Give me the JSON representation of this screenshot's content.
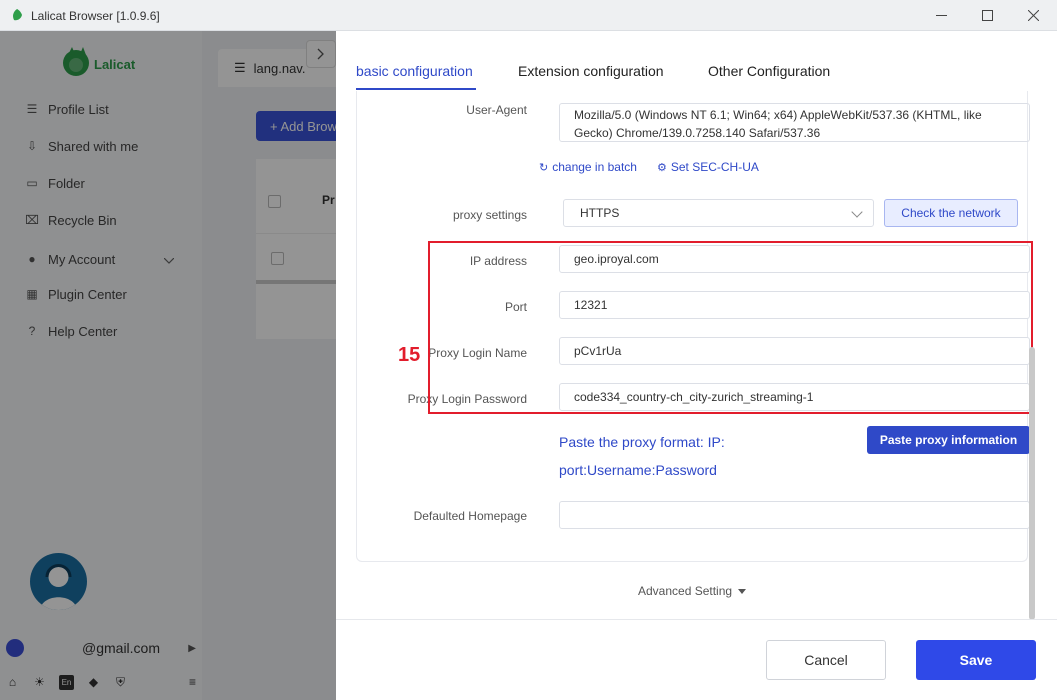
{
  "window": {
    "title": "Lalicat Browser  [1.0.9.6]",
    "minimize_icon": "minimize-icon",
    "maximize_icon": "maximize-icon",
    "close_icon": "close-icon"
  },
  "sidebar": {
    "logo_text": "Lalicat",
    "items": [
      {
        "label": "Profile List",
        "icon": "list-icon"
      },
      {
        "label": "Shared with me",
        "icon": "share-icon"
      },
      {
        "label": "Folder",
        "icon": "folder-icon"
      },
      {
        "label": "Recycle Bin",
        "icon": "trash-icon"
      },
      {
        "label": "My Account",
        "icon": "account-icon"
      },
      {
        "label": "Plugin Center",
        "icon": "plugin-icon"
      },
      {
        "label": "Help Center",
        "icon": "help-icon"
      }
    ],
    "account_email": "@gmail.com"
  },
  "background": {
    "tab_label": "lang.nav.",
    "add_button_label": "+ Add Brow",
    "column_header": "Pr"
  },
  "drawer": {
    "tabs": [
      {
        "label": "basic configuration",
        "active": true
      },
      {
        "label": "Extension configuration",
        "active": false
      },
      {
        "label": "Other Configuration",
        "active": false
      }
    ],
    "user_agent": {
      "label": "User-Agent",
      "value": "Mozilla/5.0 (Windows NT 6.1; Win64; x64) AppleWebKit/537.36 (KHTML, like Gecko) Chrome/139.0.7258.140 Safari/537.36"
    },
    "links": {
      "change_batch": "change in batch",
      "set_sec_ch_ua": "Set SEC-CH-UA"
    },
    "proxy": {
      "label": "proxy settings",
      "selected": "HTTPS",
      "check_button": "Check the network"
    },
    "annotation": "15",
    "fields": [
      {
        "label": "IP address",
        "value": "geo.iproyal.com"
      },
      {
        "label": "Port",
        "value": "12321"
      },
      {
        "label": "Proxy Login Name",
        "value": "pCv1rUa"
      },
      {
        "label": "Proxy Login Password",
        "value": "code334_country-ch_city-zurich_streaming-1"
      }
    ],
    "paste_hint_line1": "Paste the proxy format: IP:",
    "paste_hint_line2": "port:Username:Password",
    "paste_button": "Paste proxy information",
    "homepage": {
      "label": "Defaulted Homepage",
      "value": ""
    },
    "advanced": "Advanced Setting",
    "cancel": "Cancel",
    "save": "Save"
  },
  "colors": {
    "accent": "#2f49c8",
    "annotation": "#e21d2c",
    "save": "#2f49e8"
  }
}
